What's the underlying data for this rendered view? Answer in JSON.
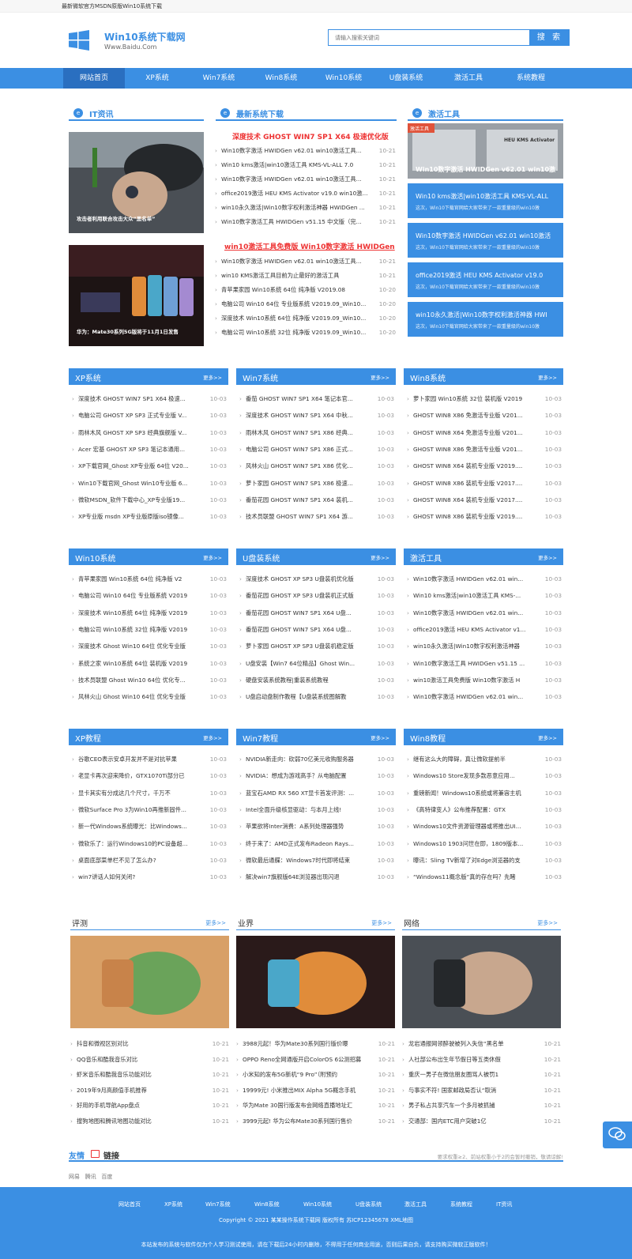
{
  "topbar": {
    "text": "最新微软官方MSDN原版Win10系统下载"
  },
  "logo": {
    "title": "Win10系统下载网",
    "sub": "Www.Baidu.Com"
  },
  "search": {
    "placeholder": "请输入搜索关键词",
    "button": "搜 索"
  },
  "nav": [
    "网站首页",
    "XP系统",
    "Win7系统",
    "Win8系统",
    "Win10系统",
    "U盘装系统",
    "激活工具",
    "系统教程"
  ],
  "it": {
    "title": "IT资讯",
    "photos": [
      {
        "cap": "攻击者利用联合攻击大众“黑名单”"
      },
      {
        "cap": "华为：Mate30系列5G版将于11月1日发售"
      }
    ]
  },
  "latest": {
    "title": "最新系统下载",
    "head1": "深度技术 GHOST WIN7 SP1 X64 极速优化版",
    "list1": [
      [
        "Win10数字激活 HWIDGen v62.01 win10激活工具...",
        "10-21"
      ],
      [
        "Win10 kms激活|win10激活工具 KMS-VL-ALL 7.0",
        "10-21"
      ],
      [
        "Win10数字激活 HWIDGen v62.01 win10激活工具...",
        "10-21"
      ],
      [
        "office2019激活 HEU KMS Activator v19.0 win10激...",
        "10-21"
      ],
      [
        "win10永久激活|Win10数字权利激活神器 HWIDGen ...",
        "10-21"
      ],
      [
        "Win10数字激活工具 HWIDGen v51.15 中文版（完...",
        "10-21"
      ]
    ],
    "head2": "win10激活工具免费版 Win10数字激活 HWIDGen",
    "list2": [
      [
        "Win10数字激活 HWIDGen v62.01 win10激活工具...",
        "10-21"
      ],
      [
        "win10 KMS激活工具目前为止最好的激活工具",
        "10-21"
      ],
      [
        "青苹果家园 Win10系统 64位 纯净版 V2019.08",
        "10-20"
      ],
      [
        "电脑公司 Win10 64位 专业版系统 V2019.09_Win10...",
        "10-20"
      ],
      [
        "深度技术 Win10系统 64位 纯净版 V2019.09_Win10...",
        "10-20"
      ],
      [
        "电脑公司 Win10系统 32位 纯净版 V2019.09_Win10...",
        "10-20"
      ]
    ]
  },
  "tools": {
    "title": "激活工具",
    "banner": "Win10数字激活 HWIDGen v62.01 win10激",
    "banner_tag": "激活工具",
    "banner_text": "HEU KMS Activator",
    "cards": [
      {
        "h": "Win10 kms激活|win10激活工具 KMS-VL-ALL",
        "s": "这次，Win10下载官网给大家带来了一款重量级的win10激"
      },
      {
        "h": "Win10数字激活 HWIDGen v62.01 win10激活",
        "s": "这次，Win10下载官网给大家带来了一款重量级的win10激"
      },
      {
        "h": "office2019激活 HEU KMS Activator v19.0",
        "s": "这次，Win10下载官网给大家带来了一款重量级的win10激"
      },
      {
        "h": "win10永久激活|Win10数字权利激活神器 HWI",
        "s": "这次，Win10下载官网给大家带来了一款重量级的win10激"
      }
    ]
  },
  "more": "更多>>",
  "cols1": [
    {
      "title": "XP系统",
      "items": [
        [
          "深度技术 GHOST WIN7 SP1 X64 极速...",
          "10-03"
        ],
        [
          "电脑公司 GHOST XP SP3 正式专业版 V...",
          "10-03"
        ],
        [
          "雨林木风 GHOST XP SP3 经典旗舰版 V...",
          "10-03"
        ],
        [
          "Acer 宏基 GHOST XP SP3 笔记本通用...",
          "10-03"
        ],
        [
          "XP下载官网_Ghost XP专业版 64位 V20...",
          "10-03"
        ],
        [
          "Win10下载官网_Ghost Win10专业版 6...",
          "10-03"
        ],
        [
          "微软MSDN_软件下载中心_XP专业版19...",
          "10-03"
        ],
        [
          "XP专业版 msdn XP专业版原版iso镜像...",
          "10-03"
        ]
      ]
    },
    {
      "title": "Win7系统",
      "items": [
        [
          "番茄 GHOST WIN7 SP1 X64 笔记本官...",
          "10-03"
        ],
        [
          "深度技术 GHOST WIN7 SP1 X64 中秋...",
          "10-03"
        ],
        [
          "雨林木风 GHOST WIN7 SP1 X86 经典...",
          "10-03"
        ],
        [
          "电脑公司 GHOST WIN7 SP1 X86 正式...",
          "10-03"
        ],
        [
          "风林火山 GHOST WIN7 SP1 X86 优化...",
          "10-03"
        ],
        [
          "萝卜家园 GHOST WIN7 SP1 X86 极速...",
          "10-03"
        ],
        [
          "番茄花园 GHOST WIN7 SP1 X64 装机...",
          "10-03"
        ],
        [
          "技术员联盟 GHOST WIN7 SP1 X64 游...",
          "10-03"
        ]
      ]
    },
    {
      "title": "Win8系统",
      "items": [
        [
          "萝卜家园 Win10系统 32位 装机版 V2019",
          "10-03"
        ],
        [
          "GHOST WIN8 X86 免激活专业版 V201...",
          "10-03"
        ],
        [
          "GHOST WIN8 X64 免激活专业版 V201...",
          "10-03"
        ],
        [
          "GHOST WIN8 X86 免激活专业版 V201...",
          "10-03"
        ],
        [
          "GHOST WIN8 X64 装机专业版 V2019....",
          "10-03"
        ],
        [
          "GHOST WIN8 X86 装机专业版 V2017....",
          "10-03"
        ],
        [
          "GHOST WIN8 X64 装机专业版 V2017....",
          "10-03"
        ],
        [
          "GHOST WIN8 X86 装机专业版 V2019....",
          "10-03"
        ]
      ]
    }
  ],
  "cols2": [
    {
      "title": "Win10系统",
      "items": [
        [
          "青苹果家园 Win10系统 64位 纯净版 V2",
          "10-03"
        ],
        [
          "电脑公司 Win10 64位 专业版系统 V2019",
          "10-03"
        ],
        [
          "深度技术 Win10系统 64位 纯净版 V2019",
          "10-03"
        ],
        [
          "电脑公司 Win10系统 32位 纯净版 V2019",
          "10-03"
        ],
        [
          "深度技术 Ghost Win10 64位 优化专业版",
          "10-03"
        ],
        [
          "系统之家 Win10系统 64位 装机版 V2019",
          "10-03"
        ],
        [
          "技术员联盟 Ghost Win10 64位 优化专...",
          "10-03"
        ],
        [
          "风林火山 Ghost Win10 64位 优化专业版",
          "10-03"
        ]
      ]
    },
    {
      "title": "U盘装系统",
      "items": [
        [
          "深度技术 GHOST XP SP3 U盘装机优化版",
          "10-03"
        ],
        [
          "番茄花园 GHOST XP SP3 U盘装机正式版",
          "10-03"
        ],
        [
          "番茄花园 GHOST WIN7 SP1 X64 U盘...",
          "10-03"
        ],
        [
          "番茄花园 GHOST WIN7 SP1 X64 U盘...",
          "10-03"
        ],
        [
          "萝卜家园 GHOST XP SP3 U盘装机稳定版",
          "10-03"
        ],
        [
          "U盘安装【Win7 64位精品】Ghost Win...",
          "10-03"
        ],
        [
          "硬盘安装系统教程|重装系统教程",
          "10-03"
        ],
        [
          "U盘启动盘制作教程【U盘装系统图解教",
          "10-03"
        ]
      ]
    },
    {
      "title": "激活工具",
      "items": [
        [
          "Win10数字激活 HWIDGen v62.01 win...",
          "10-03"
        ],
        [
          "Win10 kms激活|win10激活工具 KMS-...",
          "10-03"
        ],
        [
          "Win10数字激活 HWIDGen v62.01 win...",
          "10-03"
        ],
        [
          "office2019激活 HEU KMS Activator v1...",
          "10-03"
        ],
        [
          "win10永久激活|Win10数字权利激活神器",
          "10-03"
        ],
        [
          "Win10数字激活工具 HWIDGen v51.15 ...",
          "10-03"
        ],
        [
          "win10激活工具免费版 Win10数字激活 H",
          "10-03"
        ],
        [
          "Win10数字激活 HWIDGen v62.01 win...",
          "10-03"
        ]
      ]
    }
  ],
  "cols3": [
    {
      "title": "XP教程",
      "items": [
        [
          "谷歌CEO表示安卓开发并不是对抗苹果",
          "10-03"
        ],
        [
          "老显卡再次迎来降价，GTX1070Ti部分已",
          "10-03"
        ],
        [
          "显卡其实有分成这几个尺寸，千万不",
          "10-03"
        ],
        [
          "微软Surface Pro 3为Win10再推新固件...",
          "10-03"
        ],
        [
          "新一代Windows系统曝光：比Windows...",
          "10-03"
        ],
        [
          "微软乐了：运行Windows10的PC设备超...",
          "10-03"
        ],
        [
          "桌面底部菜单栏不见了怎么办?",
          "10-03"
        ],
        [
          "win7讲话人如何关闭?",
          "10-03"
        ]
      ]
    },
    {
      "title": "Win7教程",
      "items": [
        [
          "NVIDIA新走向：砍弱70亿美元收购服务器",
          "10-03"
        ],
        [
          "NVIDIA：想成为游戏高手？从电脑配置",
          "10-03"
        ],
        [
          "蓝宝石AMD RX 560 XT显卡首发评测：...",
          "10-03"
        ],
        [
          "Intel全面升级核显驱动：与本月上线!",
          "10-03"
        ],
        [
          "苹果欲将Inter消费：A系列处理器强势",
          "10-03"
        ],
        [
          "终于来了：AMD正式发布Radeon Rays...",
          "10-03"
        ],
        [
          "微软最后通牒：Windows7时代即将结束",
          "10-03"
        ],
        [
          "解决win7旗舰版64E浏览器出现闪退",
          "10-03"
        ]
      ]
    },
    {
      "title": "Win8教程",
      "items": [
        [
          "继有这么大的障碍，真让微软提前半",
          "10-03"
        ],
        [
          "Windows10 Store发现多款恶意应用...",
          "10-03"
        ],
        [
          "重磅新闻！Windows10系统或将兼容主机",
          "10-03"
        ],
        [
          "《高特律变人》公布推荐配置：GTX",
          "10-03"
        ],
        [
          "Windows10文件资源管理器或将推出UI...",
          "10-03"
        ],
        [
          "Windows10 1903问世在即，1809版本...",
          "10-03"
        ],
        [
          "曝讯：Sling TV新增了对Edge浏览器的支",
          "10-03"
        ],
        [
          "“Windows11概念版”真的存在吗？先睹",
          "10-03"
        ]
      ]
    }
  ],
  "pics": [
    {
      "title": "评测",
      "items": [
        [
          "抖音和微视区别对比",
          "10-21"
        ],
        [
          "QQ音乐和酷我音乐对比",
          "10-21"
        ],
        [
          "虾米音乐和酷我音乐功能对比",
          "10-21"
        ],
        [
          "2019年9月高颜值手机推荐",
          "10-21"
        ],
        [
          "好用的手机导航App盘点",
          "10-21"
        ],
        [
          "搜狗地图和腾讯地图功能对比",
          "10-21"
        ]
      ]
    },
    {
      "title": "业界",
      "items": [
        [
          "3988元起！华为Mate30系列国行版价曝",
          "10-21"
        ],
        [
          "OPPO Reno全网通版开启ColorOS 6公测招募",
          "10-21"
        ],
        [
          "小米知的发布5G新机“9 Pro”（附预约",
          "10-21"
        ],
        [
          "19999元! 小米推出MIX Alpha 5G概念手机",
          "10-21"
        ],
        [
          "华为Mate 30国行版发布会网络直播地址汇",
          "10-21"
        ],
        [
          "3999元起! 华为公布Mate30系列国行售价",
          "10-21"
        ]
      ]
    },
    {
      "title": "网络",
      "items": [
        [
          "龙岩通报网领醉驶被列入失信“黑名单",
          "10-21"
        ],
        [
          "人社部公布出生年节假日等五类休假",
          "10-21"
        ],
        [
          "重庆一男子在微信朋友圈骂人被罚1",
          "10-21"
        ],
        [
          "与事实不符! 国家邮政局否认“取消",
          "10-21"
        ],
        [
          "男子私占共享汽车一个多月被抓捕",
          "10-21"
        ],
        [
          "交通部：国内ETC用户突破1亿",
          "10-21"
        ]
      ]
    }
  ],
  "friends": {
    "title1": "友情",
    "title2": "链接",
    "note": "要求权重≥2、前站权重小于2的会暂时撤销，敬请谅解!",
    "links": [
      "网易",
      "腾讯",
      "百度"
    ]
  },
  "footer": {
    "links": [
      "网站首页",
      "XP系统",
      "Win7系统",
      "Win8系统",
      "Win10系统",
      "U盘装系统",
      "激活工具",
      "系统教程",
      "IT资讯"
    ],
    "copyright": "Copyright © 2021 某某操作系统下载网 版权所有 苏ICP12345678 XML地图",
    "disclaimer": "本站发布的系统与软件仅为个人学习测试使用，请在下载后24小时内删除，不得用于任何商业用途，否则后果自负，请支持购买微软正版软件！"
  },
  "colors": {
    "accent": "#3b8fe3",
    "red": "#e33"
  }
}
